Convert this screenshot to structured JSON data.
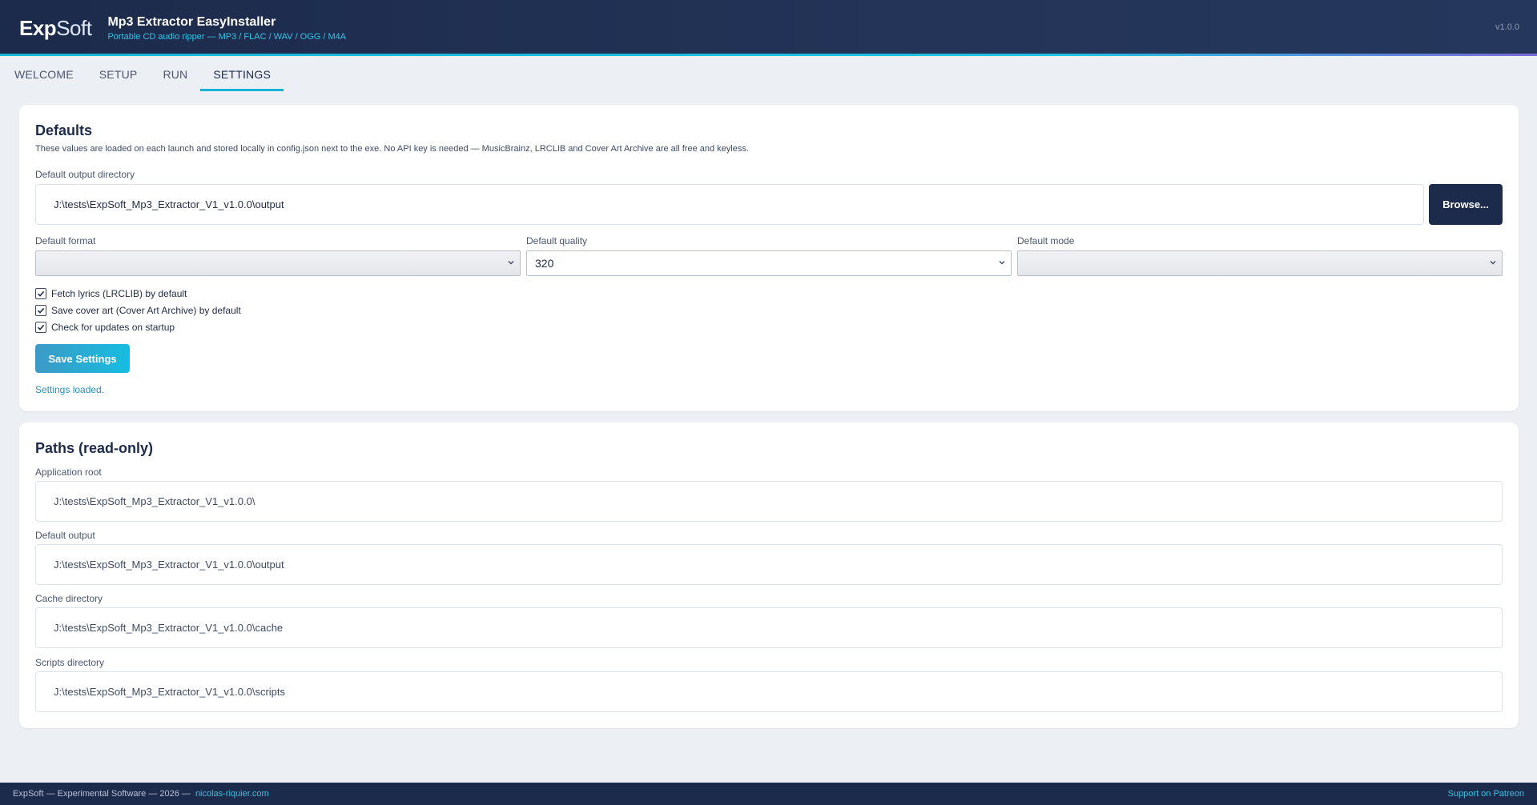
{
  "header": {
    "logo_exp": "Exp",
    "logo_soft": "Soft",
    "title": "Mp3 Extractor EasyInstaller",
    "subtitle": "Portable CD audio ripper — MP3 / FLAC / WAV / OGG / M4A",
    "version": "v1.0.0"
  },
  "tabs": [
    {
      "label": "WELCOME",
      "active": false
    },
    {
      "label": "SETUP",
      "active": false
    },
    {
      "label": "RUN",
      "active": false
    },
    {
      "label": "SETTINGS",
      "active": true
    }
  ],
  "defaults": {
    "title": "Defaults",
    "description": "These values are loaded on each launch and stored locally in config.json next to the exe. No API key is needed — MusicBrainz, LRCLIB and Cover Art Archive are all free and keyless.",
    "output_dir_label": "Default output directory",
    "output_dir_value": "J:\\tests\\ExpSoft_Mp3_Extractor_V1_v1.0.0\\output",
    "browse_label": "Browse...",
    "format_label": "Default format",
    "format_value": "",
    "quality_label": "Default quality",
    "quality_value": "320",
    "mode_label": "Default mode",
    "mode_value": "",
    "checkboxes": [
      {
        "label": "Fetch lyrics (LRCLIB) by default",
        "checked": true
      },
      {
        "label": "Save cover art (Cover Art Archive) by default",
        "checked": true
      },
      {
        "label": "Check for updates on startup",
        "checked": true
      }
    ],
    "save_label": "Save Settings",
    "status": "Settings loaded."
  },
  "paths": {
    "title": "Paths (read-only)",
    "items": [
      {
        "label": "Application root",
        "value": "J:\\tests\\ExpSoft_Mp3_Extractor_V1_v1.0.0\\"
      },
      {
        "label": "Default output",
        "value": "J:\\tests\\ExpSoft_Mp3_Extractor_V1_v1.0.0\\output"
      },
      {
        "label": "Cache directory",
        "value": "J:\\tests\\ExpSoft_Mp3_Extractor_V1_v1.0.0\\cache"
      },
      {
        "label": "Scripts directory",
        "value": "J:\\tests\\ExpSoft_Mp3_Extractor_V1_v1.0.0\\scripts"
      }
    ]
  },
  "footer": {
    "text": "ExpSoft — Experimental Software — 2026 —",
    "link": "nicolas-riquier.com",
    "right_link": "Support on Patreon"
  },
  "colors": {
    "header_bg": "#1c2a4b",
    "accent": "#19b3d6",
    "page_bg": "#eceff3"
  }
}
